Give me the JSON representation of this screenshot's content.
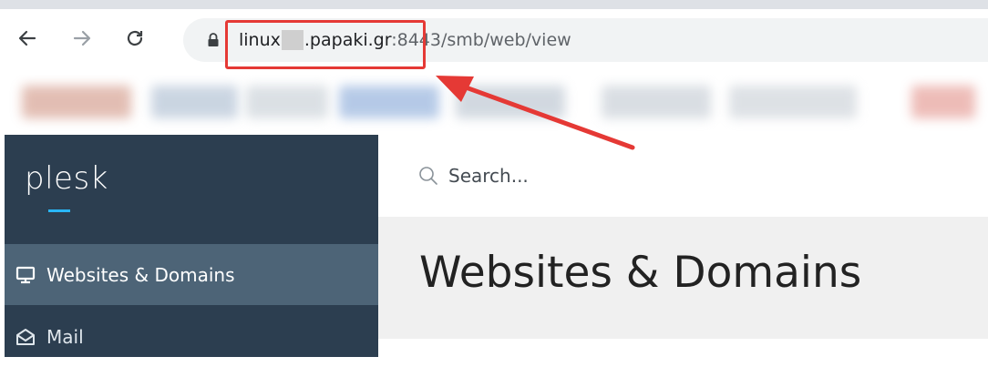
{
  "browser": {
    "url_host_prefix": "linux",
    "url_host_suffix": ".papaki.gr",
    "url_path": ":8443/smb/web/view",
    "back_icon": "arrow-left-icon",
    "forward_icon": "arrow-right-icon",
    "reload_icon": "reload-icon",
    "lock_icon": "lock-icon",
    "annotation_color": "#e53935"
  },
  "plesk": {
    "logo": "plesk",
    "search_placeholder": "Search...",
    "page_title": "Websites & Domains",
    "sidebar": {
      "items": [
        {
          "label": "Websites & Domains",
          "icon": "monitor-icon",
          "active": true
        },
        {
          "label": "Mail",
          "icon": "envelope-open-icon",
          "active": false
        }
      ]
    },
    "colors": {
      "sidebar_bg": "#2c3e50",
      "active_item_bg": "#4d6477",
      "logo_accent": "#29b6f6"
    }
  }
}
